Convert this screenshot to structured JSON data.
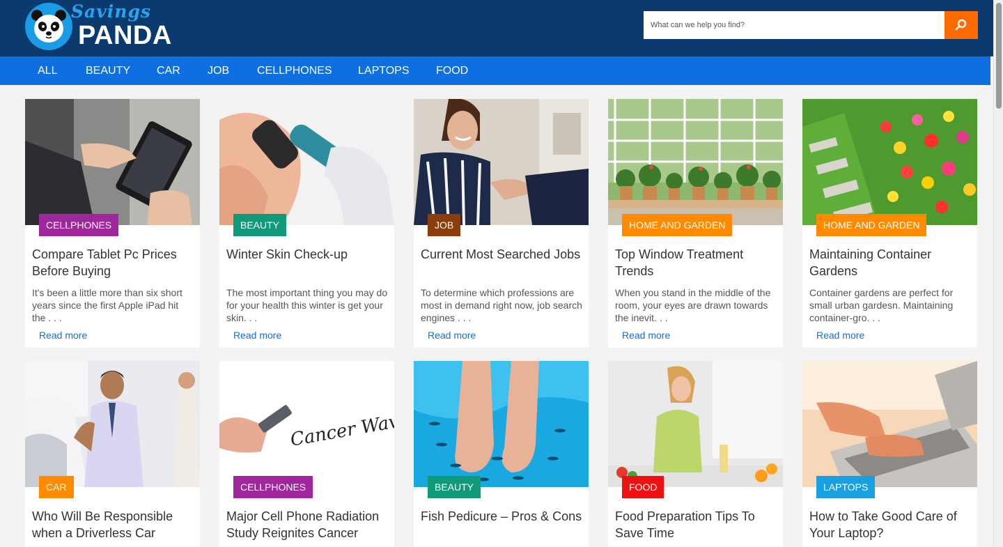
{
  "brand": {
    "savings": "Savings",
    "panda": "PANDA"
  },
  "search": {
    "placeholder": "What can we help you find?",
    "icon": "search-icon"
  },
  "nav": [
    "ALL",
    "BEAUTY",
    "CAR",
    "JOB",
    "CELLPHONES",
    "LAPTOPS",
    "FOOD"
  ],
  "colors": {
    "header": "#0b3a6e",
    "nav": "#0d6fe0",
    "accent": "#ff6a00",
    "cellphones": "#a0269c",
    "beauty": "#109a7a",
    "job": "#8b3d0e",
    "home_and_garden": "#ff8a00",
    "car": "#ff8a00",
    "food": "#ee1111",
    "laptops": "#1a9fe0"
  },
  "cards": [
    {
      "category": "CELLPHONES",
      "title": "Compare Tablet Pc Prices Before Buying",
      "excerpt": "It's been a little more than six short years since the first Apple iPad hit the . . .",
      "read_more": "Read more",
      "image": "hands-with-tablet"
    },
    {
      "category": "BEAUTY",
      "title": "Winter Skin Check-up",
      "excerpt": "The most important thing you may do for your health this winter is get your skin. . .",
      "read_more": "Read more",
      "image": "dermatoscope-on-skin"
    },
    {
      "category": "JOB",
      "title": "Current Most Searched Jobs",
      "excerpt": "To determine which professions are most in demand right now, job search engines . . .",
      "read_more": "Read more",
      "image": "woman-handshake"
    },
    {
      "category": "HOME AND GARDEN",
      "title": "Top Window Treatment Trends",
      "excerpt": "When you stand in the middle of the room, your eyes are drawn towards the inevit. . .",
      "read_more": "Read more",
      "image": "window-plants"
    },
    {
      "category": "HOME AND GARDEN",
      "title": "Maintaining Container Gardens",
      "excerpt": "Container gardens are perfect for small urban gardesn. Maintaining container-gro. . .",
      "read_more": "Read more",
      "image": "flower-garden-path"
    },
    {
      "category": "CAR",
      "title": "Who Will Be Responsible when a Driverless Car",
      "image": "car-salesman"
    },
    {
      "category": "CELLPHONES",
      "title": "Major Cell Phone Radiation Study Reignites Cancer",
      "image": "phone-cancer-waves",
      "image_text": "Cancer Waves"
    },
    {
      "category": "BEAUTY",
      "title": "Fish Pedicure – Pros & Cons",
      "image": "fish-pedicure"
    },
    {
      "category": "FOOD",
      "title": "Food Preparation Tips To Save Time",
      "image": "kitchen-woman"
    },
    {
      "category": "LAPTOPS",
      "title": "How to Take Good Care of Your Laptop?",
      "image": "hands-on-laptop"
    }
  ]
}
